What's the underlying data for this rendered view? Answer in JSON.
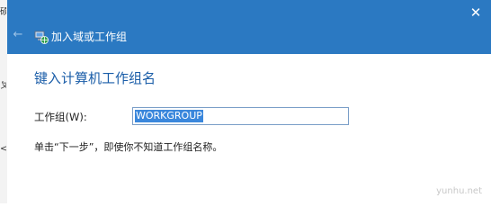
{
  "background": {
    "edge_glyphs": [
      "硕",
      "ㄆ",
      "<"
    ]
  },
  "titlebar": {
    "close_label": "✕",
    "back_label": "←",
    "wizard_icon": "network-computer-icon",
    "title": "加入域或工作组"
  },
  "content": {
    "heading": "键入计算机工作组名",
    "field_label": "工作组(W):",
    "field_value": "WORKGROUP",
    "hint": "单击“下一步”，即使你不知道工作组名称。"
  },
  "watermark": "yunhu.net",
  "colors": {
    "titlebar_bg": "#2b79c2",
    "heading": "#1a5da8",
    "selection": "#3a87dc"
  }
}
